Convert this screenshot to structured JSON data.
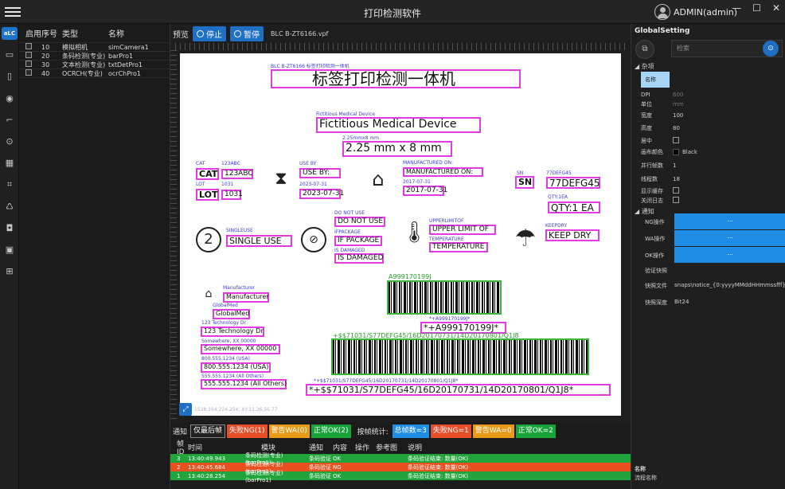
{
  "app": {
    "title": "打印检测软件",
    "user": "ADMIN(admin)",
    "logo": "aLC"
  },
  "window_controls": {
    "minimize": "—",
    "maximize": "☐",
    "close": "✕"
  },
  "nav_icons": [
    "monitor-icon",
    "file-icon",
    "eye-icon",
    "crop-icon",
    "target-icon",
    "grid-icon",
    "scan-icon",
    "recycle-icon",
    "camera-icon",
    "image-icon",
    "apps-icon"
  ],
  "list": {
    "headers": {
      "enabled": "启用",
      "no": "序号",
      "type": "类型",
      "name": "名称"
    },
    "rows": [
      {
        "no": "10",
        "type": "模拟相机",
        "name": "simCamera1"
      },
      {
        "no": "20",
        "type": "条码检测(专业)",
        "name": "barPro1"
      },
      {
        "no": "30",
        "type": "文本检测(专业)",
        "name": "txtDetPro1"
      },
      {
        "no": "40",
        "type": "OCRCH(专业)",
        "name": "ocrChPro1"
      }
    ]
  },
  "preview": {
    "label": "预览",
    "stop": "停止",
    "pause": "暂停",
    "file": "BLC B-ZT6166.vpf",
    "status": "1538,164,224,254; XY:11.26,56.77"
  },
  "label": {
    "header_small": "BLC B-ZT6166 标签打印检测一体机",
    "header_big": "标签打印检测一体机",
    "fmd_small": "Fictitious Medical Device",
    "fmd_big": "Fictitious Medical Device",
    "size_small": "2.25mmx8 mm",
    "size_big": "2.25 mm x 8 mm",
    "cat_small": "CAT",
    "cat_big": "CAT",
    "cat_no_small": "123ABC",
    "cat_no_big": "123ABC",
    "lot_small": "LOT",
    "lot_big": "LOT",
    "lot_no_small": "1031",
    "lot_no_big": "1031",
    "useby_small": "USE BY",
    "useby_big": "USE BY:",
    "useby_date_small": "2023-07-31",
    "useby_date_big": "2023-07-31",
    "mfg_on_small": "MANUFACTURED ON:",
    "mfg_on_big": "MANUFACTURED ON:",
    "mfg_date_small": "2017-07-31",
    "mfg_date_big": "2017-07-31",
    "sn_small": "SN",
    "sn_big": "SN",
    "sn_no_small": "77DEFG45",
    "sn_no_big": "77DEFG45",
    "qty_small": "QTY:1EA",
    "qty_big": "QTY:1 EA",
    "single_small": "SINGLEUSE",
    "single_big": "SINGLE USE",
    "dnu_small": "DO NOT USE",
    "dnu_big": "DO NOT USE",
    "ifpkg_small": "IFPACKAGE",
    "ifpkg_big": "IF PACKAGE",
    "damaged_small": "IS DAMAGED",
    "damaged_big": "IS DAMAGED",
    "upper_small": "UPPERLIMITOF",
    "upper_big": "UPPER LIMIT OF",
    "temp_small": "TEMPERATURE",
    "temp_big": "TEMPERATURE",
    "dry_small": "KEEPDRY",
    "dry_big": "KEEP DRY",
    "manufacturer_small": "Manufacturer",
    "manufacturer_big": "Manufacturer",
    "globalmed_small": "GlobalMed",
    "globalmed_big": "GlobalMed",
    "addr1_small": "123 Technology Dr",
    "addr1_big": "123 Technology Dr",
    "addr2_small": "Somewhere, XX 00000",
    "addr2_big": "Somewhere, XX 00000",
    "phone1_small": "800.555.1234 (USA)",
    "phone1_big": "800.555.1234 (USA)",
    "phone2_small": "555.555.1234 (All Others)",
    "phone2_big": "555.555.1234 (All Others)",
    "bc1_top": "A999170199J",
    "bc1_small": "*+A999170199J*",
    "bc1_big": "*+A999170199J*",
    "bc2_top": "+$$71031/S77DEFG45/16D20170731/14D20170801/Q1J8",
    "bc2_small": "*+$$71031/S77DEFG45/16D20170731/14D20170801/Q1J8*",
    "bc2_big": "*+$$71031/S77DEFG45/16D20170731/14D20170801/Q1J8*"
  },
  "global": {
    "title": "GlobalSetting",
    "search_placeholder": "检索",
    "section_misc": "杂项",
    "name_key": "名称",
    "props": [
      {
        "key": "DPI",
        "value": "600",
        "dim": true
      },
      {
        "key": "单位",
        "value": "mm",
        "dim": true
      },
      {
        "key": "宽度",
        "value": "100",
        "dim": false
      },
      {
        "key": "高度",
        "value": "80",
        "dim": false
      },
      {
        "key": "居中",
        "value": "",
        "dim": false
      },
      {
        "key": "画布颜色",
        "value": "Black",
        "dim": false
      },
      {
        "key": "并行帧数",
        "value": "1",
        "dim": false
      },
      {
        "key": "线程数",
        "value": "18",
        "dim": false
      },
      {
        "key": "显示缓存",
        "value": "",
        "dim": false
      },
      {
        "key": "关闭日志",
        "value": "",
        "dim": false
      }
    ],
    "section_notify": "通知",
    "events": [
      {
        "key": "NG操作",
        "value": "..."
      },
      {
        "key": "WA操作",
        "value": "..."
      },
      {
        "key": "OK操作",
        "value": "..."
      }
    ],
    "snapshot_section": "验证快照",
    "snap_file_key": "快照文件",
    "snap_file_value": "snaps\\notice_{0:yyyyMMddHHmmssfff}",
    "snap_depth_key": "快照深度",
    "snap_depth_value": "Bit24",
    "footer_title": "名称",
    "footer_desc": "流程名称"
  },
  "notify": {
    "label": "通知",
    "chips": [
      {
        "text": "仅最后帧",
        "color": "outline"
      },
      {
        "text": "失败NG(1)",
        "color": "red"
      },
      {
        "text": "警告WA(0)",
        "color": "orange"
      },
      {
        "text": "正常OK(2)",
        "color": "green"
      }
    ],
    "stats_label": "按帧统计:",
    "stats": [
      {
        "text": "总帧数=3",
        "color": "blue"
      },
      {
        "text": "失败NG=1",
        "color": "red"
      },
      {
        "text": "警告WA=0",
        "color": "orange"
      },
      {
        "text": "正常OK=2",
        "color": "green"
      }
    ]
  },
  "log": {
    "headers": {
      "id": "帧ID",
      "time": "时间",
      "module": "模块",
      "notice": "通知",
      "content": "内容",
      "op": "操作",
      "ref": "参考图",
      "desc": "说明"
    },
    "rows": [
      {
        "id": "3",
        "time": "13:40:49.943",
        "module": "条码检测(专业)(barPro1)",
        "notice": "条码验证",
        "content": "OK",
        "desc": "条码验证结束: 数量(OK)",
        "status": "ok"
      },
      {
        "id": "2",
        "time": "13:40:45.684",
        "module": "条码检测(专业)(barPro1)",
        "notice": "条码验证",
        "content": "NG",
        "desc": "条码验证结束: 数量(OK)",
        "status": "ng"
      },
      {
        "id": "1",
        "time": "13:40:28.254",
        "module": "条码检测(专业)(barPro1)",
        "notice": "条码验证",
        "content": "OK",
        "desc": "条码验证结束: 数量(OK)",
        "status": "ok"
      }
    ]
  }
}
